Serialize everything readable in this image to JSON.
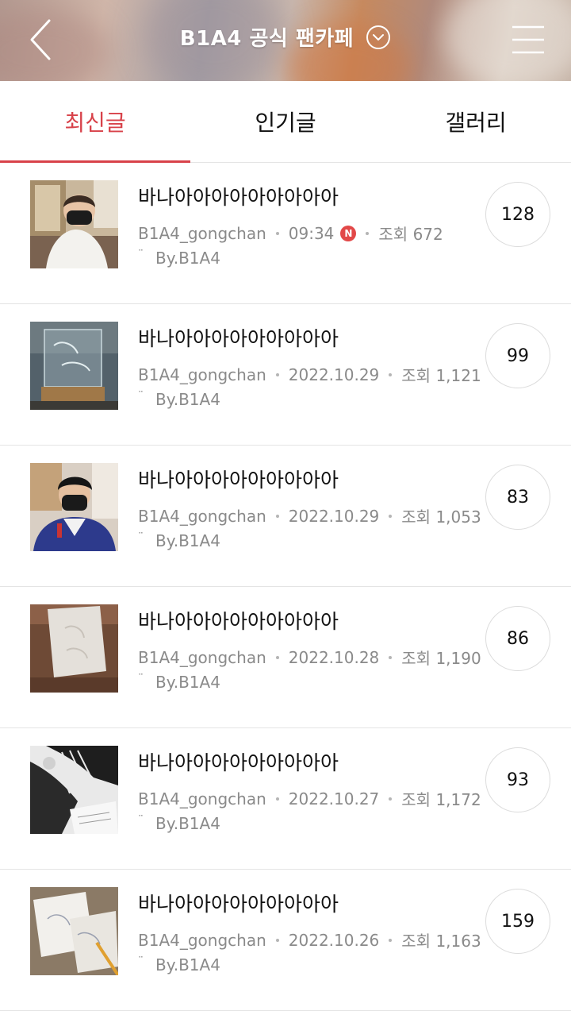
{
  "header": {
    "title": "B1A4 공식 팬카페"
  },
  "tabs": [
    {
      "label": "최신글",
      "active": true
    },
    {
      "label": "인기글",
      "active": false
    },
    {
      "label": "갤러리",
      "active": false
    }
  ],
  "colors": {
    "accent": "#d8424a",
    "new_badge": "#e24848",
    "meta_text": "#8a8a8a"
  },
  "posts": [
    {
      "title": "바나아아아아아아아아아",
      "author": "B1A4_gongchan",
      "date": "09:34",
      "is_new": true,
      "new_label": "N",
      "views": "조회 672",
      "byline": "By.B1A4",
      "comments": "128"
    },
    {
      "title": "바나아아아아아아아아아",
      "author": "B1A4_gongchan",
      "date": "2022.10.29",
      "is_new": false,
      "new_label": "",
      "views": "조회 1,121",
      "byline": "By.B1A4",
      "comments": "99"
    },
    {
      "title": "바나아아아아아아아아아",
      "author": "B1A4_gongchan",
      "date": "2022.10.29",
      "is_new": false,
      "new_label": "",
      "views": "조회 1,053",
      "byline": "By.B1A4",
      "comments": "83"
    },
    {
      "title": "바나아아아아아아아아아",
      "author": "B1A4_gongchan",
      "date": "2022.10.28",
      "is_new": false,
      "new_label": "",
      "views": "조회 1,190",
      "byline": "By.B1A4",
      "comments": "86"
    },
    {
      "title": "바나아아아아아아아아아",
      "author": "B1A4_gongchan",
      "date": "2022.10.27",
      "is_new": false,
      "new_label": "",
      "views": "조회 1,172",
      "byline": "By.B1A4",
      "comments": "93"
    },
    {
      "title": "바나아아아아아아아아아",
      "author": "B1A4_gongchan",
      "date": "2022.10.26",
      "is_new": false,
      "new_label": "",
      "views": "조회 1,163",
      "byline": "By.B1A4",
      "comments": "159"
    }
  ]
}
